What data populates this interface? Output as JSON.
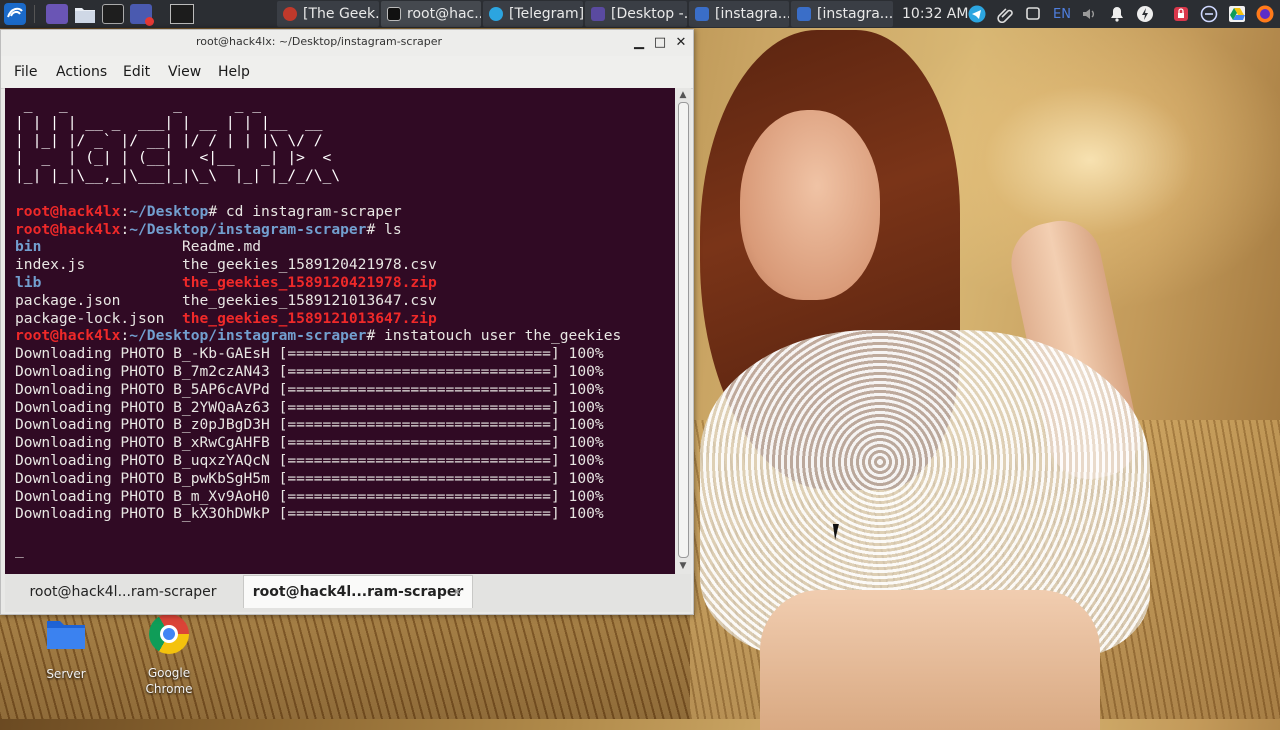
{
  "taskbar": {
    "tasks": [
      {
        "label": "[The Geek...",
        "color": "#c0392b"
      },
      {
        "label": "root@hac...",
        "color": "#2b2e33"
      },
      {
        "label": "[Telegram]",
        "color": "#2ca5e0"
      },
      {
        "label": "[Desktop -...",
        "color": "#5a4aa0"
      },
      {
        "label": "[instagra...",
        "color": "#3a6ec8"
      },
      {
        "label": "[instagra...",
        "color": "#3a6ec8"
      }
    ],
    "clock": "10:32 AM",
    "keyboard_layout": "EN"
  },
  "window": {
    "title": "root@hack4lx: ~/Desktop/instagram-scraper",
    "minimize": "▁",
    "maximize": "□",
    "close": "✕"
  },
  "menu": {
    "file": "File",
    "actions": "Actions",
    "edit": "Edit",
    "view": "View",
    "help": "Help"
  },
  "terminal": {
    "banner": [
      " _   _            _      _ _       ",
      "| | | | __ _  ___| | __ | | |__  __",
      "| |_| |/ _` |/ __| |/ / | | |\\ \\/ /",
      "|  _  | (_| | (__|   <|__   _| |>  < ",
      "|_| |_|\\__,_|\\___|_|\\_\\  |_| |_/_/\\_\\"
    ],
    "user": "root@hack4lx",
    "prompt1_path": "~/Desktop",
    "cmd1": "cd instagram-scraper",
    "prompt2_path": "~/Desktop/instagram-scraper",
    "cmd2": "ls",
    "ls": [
      {
        "left": "bin",
        "left_dir": true,
        "right": "Readme.md",
        "right_zip": false
      },
      {
        "left": "index.js",
        "left_dir": false,
        "right": "the_geekies_1589120421978.csv",
        "right_zip": false
      },
      {
        "left": "lib",
        "left_dir": true,
        "right": "the_geekies_1589120421978.zip",
        "right_zip": true
      },
      {
        "left": "package.json",
        "left_dir": false,
        "right": "the_geekies_1589121013647.csv",
        "right_zip": false
      },
      {
        "left": "package-lock.json",
        "left_dir": false,
        "right": "the_geekies_1589121013647.zip",
        "right_zip": true
      }
    ],
    "prompt3_path": "~/Desktop/instagram-scraper",
    "cmd3": "instatouch user the_geekies",
    "downloads": [
      "Downloading PHOTO B_-Kb-GAEsH [==============================] 100%",
      "Downloading PHOTO B_7m2czAN43 [==============================] 100%",
      "Downloading PHOTO B_5AP6cAVPd [==============================] 100%",
      "Downloading PHOTO B_2YWQaAz63 [==============================] 100%",
      "Downloading PHOTO B_z0pJBgD3H [==============================] 100%",
      "Downloading PHOTO B_xRwCgAHFB [==============================] 100%",
      "Downloading PHOTO B_uqxzYAQcN [==============================] 100%",
      "Downloading PHOTO B_pwKbSgH5m [==============================] 100%",
      "Downloading PHOTO B_m_Xv9AoH0 [==============================] 100%",
      "Downloading PHOTO B_kX3OhDWkP [==============================] 100%"
    ],
    "cursor": "_"
  },
  "tabs": [
    {
      "label": "root@hack4l...ram-scraper",
      "active": false
    },
    {
      "label": "root@hack4l...ram-scraper",
      "active": true,
      "close": "×"
    }
  ],
  "desktop_icons": [
    {
      "label": "Server"
    },
    {
      "label": "Google\nChrome"
    }
  ]
}
